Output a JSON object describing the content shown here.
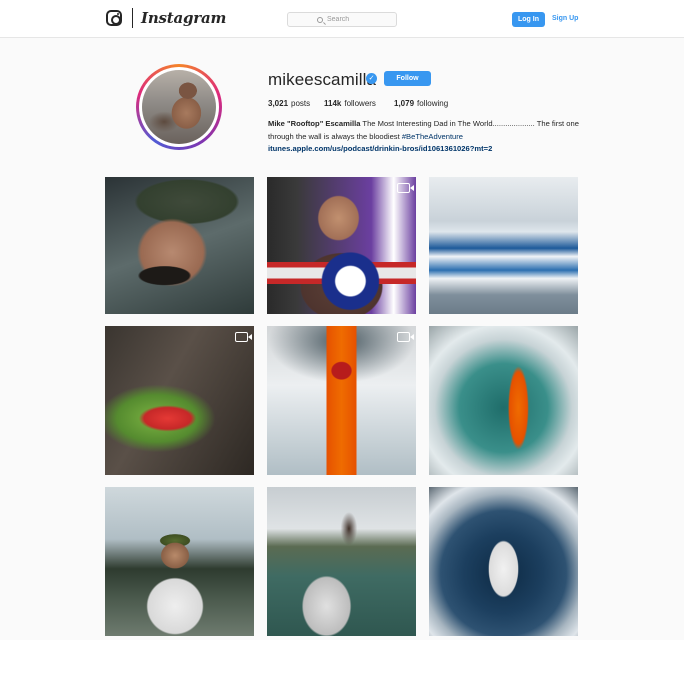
{
  "nav": {
    "wordmark": "Instagram",
    "search_placeholder": "Search",
    "login_label": "Log In",
    "signup_label": "Sign Up",
    "icons": [
      "instagram-logo-icon",
      "search-icon"
    ],
    "accent_color": "#3897f0"
  },
  "profile": {
    "username": "mikeescamilla",
    "verified": true,
    "follow_label": "Follow",
    "stats": {
      "posts_num": "3,021",
      "posts_label": "posts",
      "followers_num": "114k",
      "followers_label": "followers",
      "following_num": "1,079",
      "following_label": "following"
    },
    "bio": {
      "name": "Mike \"Rooftop\" Escamilla",
      "text": " The Most Interesting Dad in The World.................... The first one through the wall is always the bloodiest ",
      "hashtag": "#BeTheAdventure",
      "link": "itunes.apple.com/us/podcast/drinkin-bros/id1061361026?mt=2"
    }
  },
  "posts": [
    {
      "subject": "bearded man in cap portrait",
      "video": false
    },
    {
      "subject": "man in cap talking, video",
      "video": true
    },
    {
      "subject": "snowy mountains and boat",
      "video": false
    },
    {
      "subject": "red and green flowers on rocks, video",
      "video": true
    },
    {
      "subject": "orange kayak from above, video",
      "video": true
    },
    {
      "subject": "kayaker in turquoise water",
      "video": false
    },
    {
      "subject": "man in camo cap by lake",
      "video": false
    },
    {
      "subject": "man standing on boat fishing",
      "video": false
    },
    {
      "subject": "fisheye boat on water",
      "video": false
    }
  ]
}
